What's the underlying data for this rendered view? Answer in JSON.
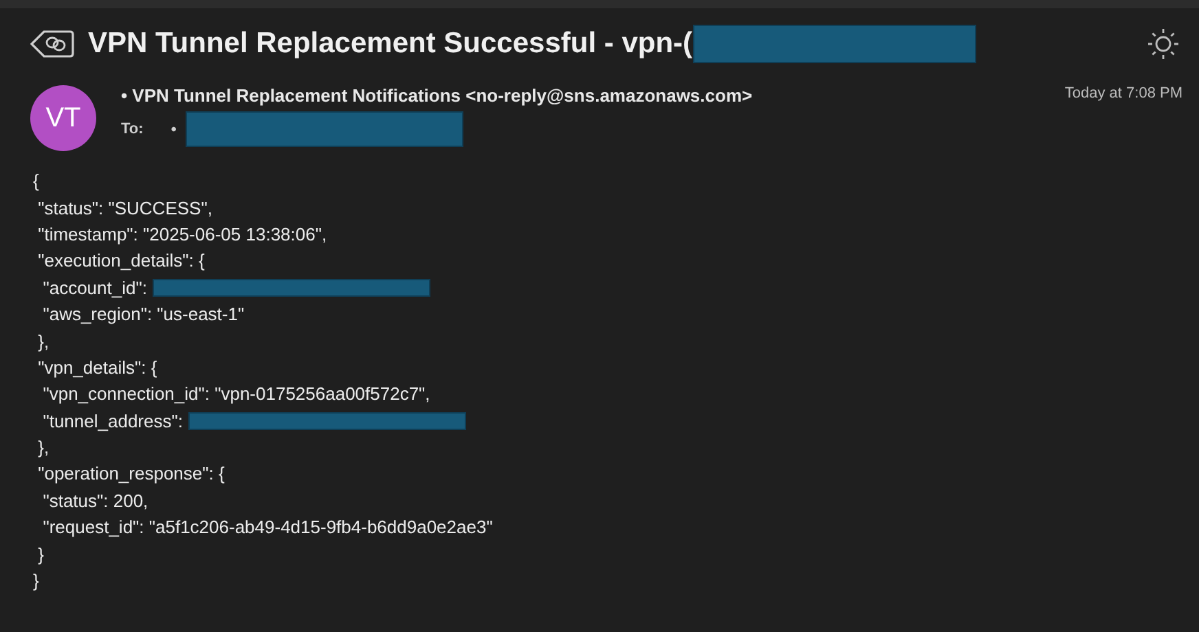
{
  "email": {
    "subject": "VPN Tunnel Replacement Successful - vpn-(",
    "subject_redacted": true,
    "avatar": "VT",
    "sender": "• VPN Tunnel Replacement Notifications <no-reply@sns.amazonaws.com>",
    "to_label": "To:",
    "to_bullet": "•",
    "to_redacted": true,
    "time": "Today at 7:08 PM"
  },
  "body": [
    {
      "text": "{",
      "redacted": false
    },
    {
      "text": " \"status\": \"SUCCESS\",",
      "redacted": false
    },
    {
      "text": " \"timestamp\": \"2025-06-05 13:38:06\",",
      "redacted": false
    },
    {
      "text": " \"execution_details\": {",
      "redacted": false
    },
    {
      "text": "  \"account_id\":",
      "redacted": true
    },
    {
      "text": "  \"aws_region\": \"us-east-1\"",
      "redacted": false
    },
    {
      "text": " },",
      "redacted": false
    },
    {
      "text": " \"vpn_details\": {",
      "redacted": false
    },
    {
      "text": "  \"vpn_connection_id\": \"vpn-0175256aa00f572c7\",",
      "redacted": false
    },
    {
      "text": "  \"tunnel_address\":",
      "redacted": true
    },
    {
      "text": " },",
      "redacted": false
    },
    {
      "text": " \"operation_response\": {",
      "redacted": false
    },
    {
      "text": "  \"status\": 200,",
      "redacted": false
    },
    {
      "text": "  \"request_id\": \"a5f1c206-ab49-4d15-9fb4-b6dd9a0e2ae3\"",
      "redacted": false
    },
    {
      "text": " }",
      "redacted": false
    },
    {
      "text": "}",
      "redacted": false
    }
  ]
}
